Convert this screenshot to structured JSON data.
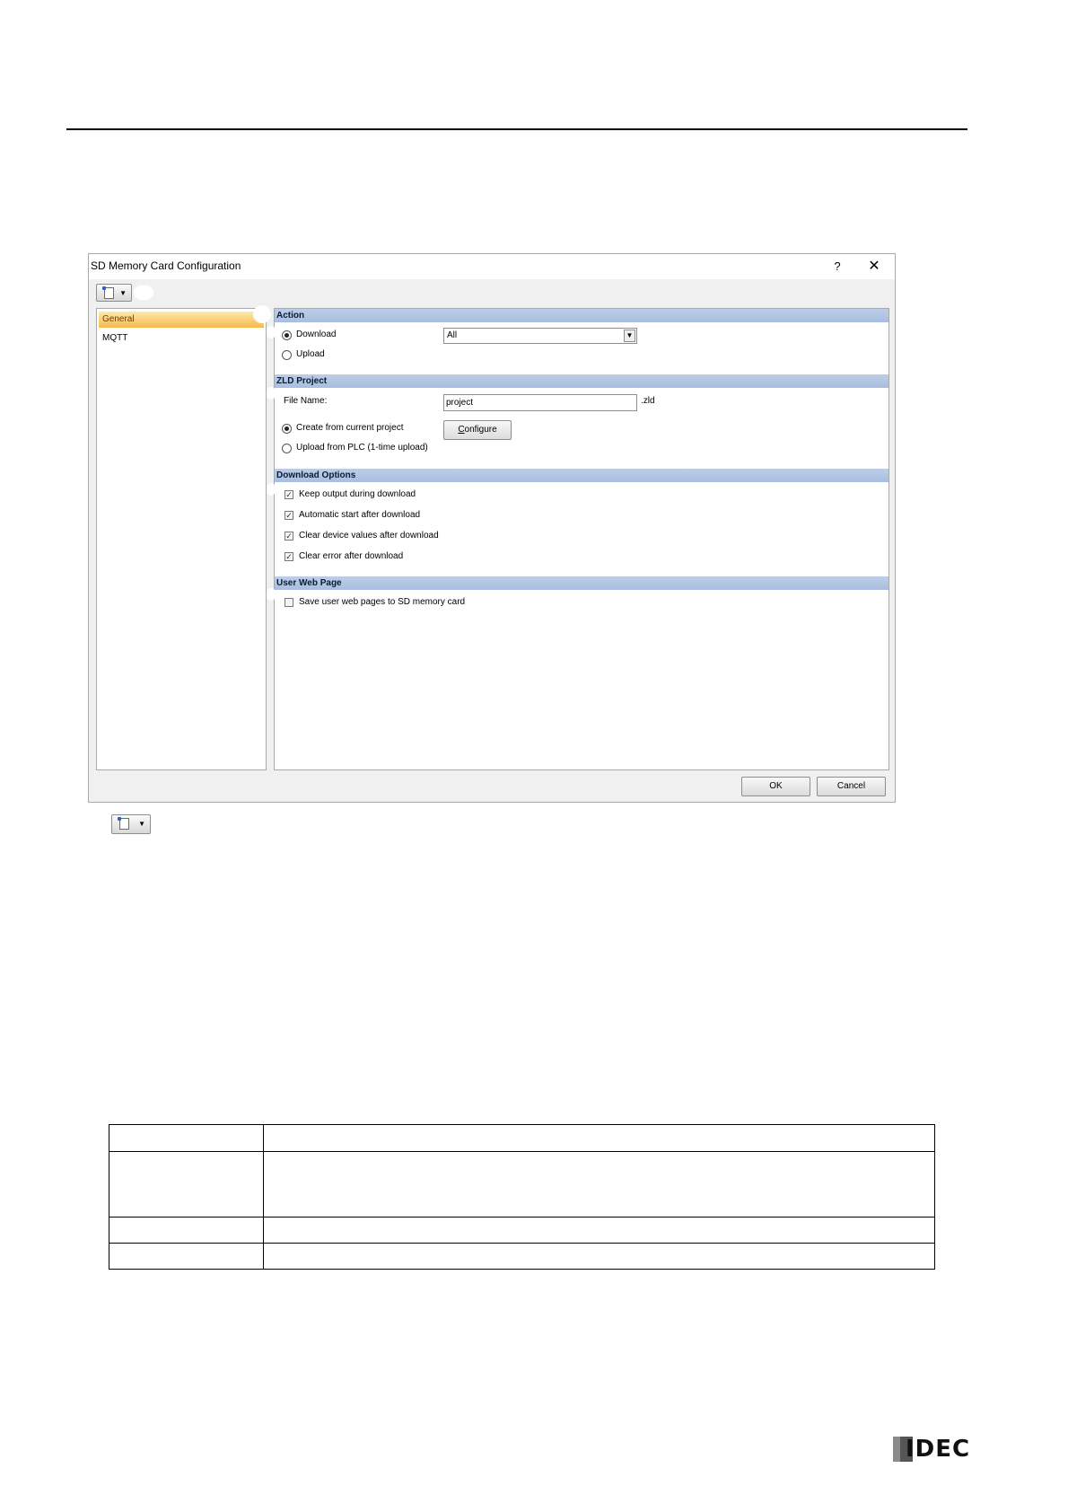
{
  "dialog": {
    "title": "SD Memory Card Configuration",
    "help_label": "?",
    "close_label": "✕"
  },
  "tree": {
    "items": [
      {
        "label": "General",
        "selected": true
      },
      {
        "label": "MQTT",
        "selected": false
      }
    ]
  },
  "sections": {
    "action": {
      "header": "Action",
      "download_label": "Download",
      "upload_label": "Upload",
      "selected": "Download",
      "select_value": "All"
    },
    "zld_project": {
      "header": "ZLD Project",
      "file_name_label": "File Name:",
      "file_name_value": "project",
      "extension": ".zld",
      "create_label": "Create from current project",
      "upload_label": "Upload from PLC (1-time upload)",
      "selected": "Create from current project",
      "configure_label_accel": "C",
      "configure_label_rest": "onfigure"
    },
    "download_options": {
      "header": "Download Options",
      "options": [
        {
          "label": "Keep output during download",
          "checked": true
        },
        {
          "label": "Automatic start after download",
          "checked": true
        },
        {
          "label": "Clear device values after download",
          "checked": true
        },
        {
          "label": "Clear error after download",
          "checked": true
        }
      ]
    },
    "user_web_page": {
      "header": "User Web Page",
      "save_label": "Save user web pages to SD memory card",
      "checked": false
    }
  },
  "footer": {
    "ok_label": "OK",
    "cancel_label": "Cancel"
  },
  "logo": {
    "text": "IDEC"
  },
  "icons": {
    "toolbar_button": "new-document-dropdown-icon"
  }
}
